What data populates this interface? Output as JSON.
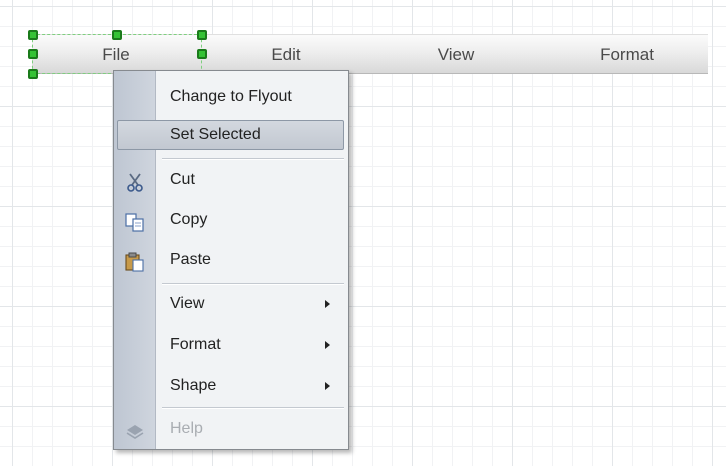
{
  "menubar": {
    "items": [
      "File",
      "Edit",
      "View",
      "Format"
    ]
  },
  "context_menu": {
    "items": [
      {
        "label": "Change to Flyout"
      },
      {
        "label": "Set Selected",
        "state": "highlighted"
      },
      {
        "label": "Cut",
        "icon": "scissors-icon"
      },
      {
        "label": "Copy",
        "icon": "copy-icon"
      },
      {
        "label": "Paste",
        "icon": "paste-icon"
      },
      {
        "label": "View",
        "submenu": true
      },
      {
        "label": "Format",
        "submenu": true
      },
      {
        "label": "Shape",
        "submenu": true
      },
      {
        "label": "Help",
        "icon": "help-icon",
        "state": "disabled"
      }
    ]
  },
  "colors": {
    "selection_handle": "#35c235",
    "menu_highlight": "#c8ced6",
    "icon_strip": "#c5ccd7"
  }
}
